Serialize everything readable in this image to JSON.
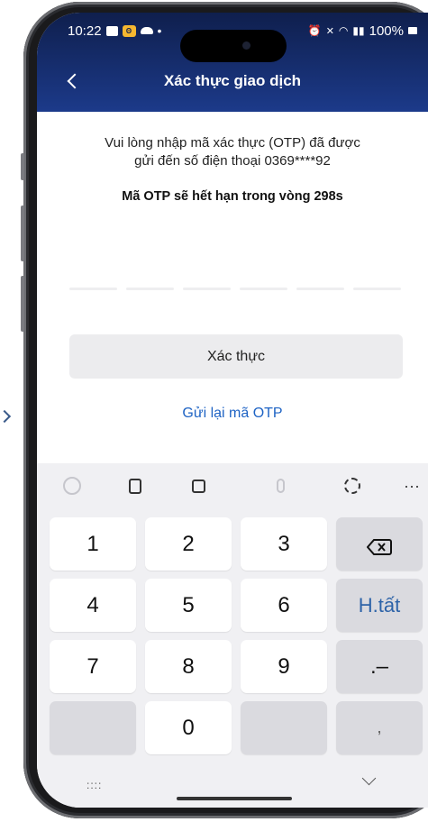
{
  "status_bar": {
    "time": "10:22",
    "battery": "100%"
  },
  "header": {
    "title": "Xác thực giao dịch"
  },
  "content": {
    "instruction_line1": "Vui lòng nhập mã xác thực (OTP) đã được",
    "instruction_line2": "gửi đến số điện thoại  0369****92",
    "expiry_label": "Mã OTP sẽ hết hạn trong vòng  298s",
    "otp_digits": [
      "",
      "",
      "",
      "",
      "",
      ""
    ],
    "confirm_label": "Xác thực",
    "resend_label": "Gửi lại mã OTP"
  },
  "keyboard": {
    "toolbar": [
      "smiley-icon",
      "clipboard-icon",
      "keyboard-icon",
      "mic-icon",
      "settings-icon",
      "more-icon"
    ],
    "keys": {
      "k1": "1",
      "k2": "2",
      "k3": "3",
      "k4": "4",
      "k5": "5",
      "k6": "6",
      "k7": "7",
      "k8": "8",
      "k9": "9",
      "k0": "0",
      "done": "H.tất",
      "dot_dash": ".–",
      "comma": ","
    },
    "more_label": "···",
    "grid_label": "::::"
  },
  "colors": {
    "header_bg": "#1c3a8a",
    "link": "#1e63c4",
    "done_key": "#2d63a8"
  }
}
